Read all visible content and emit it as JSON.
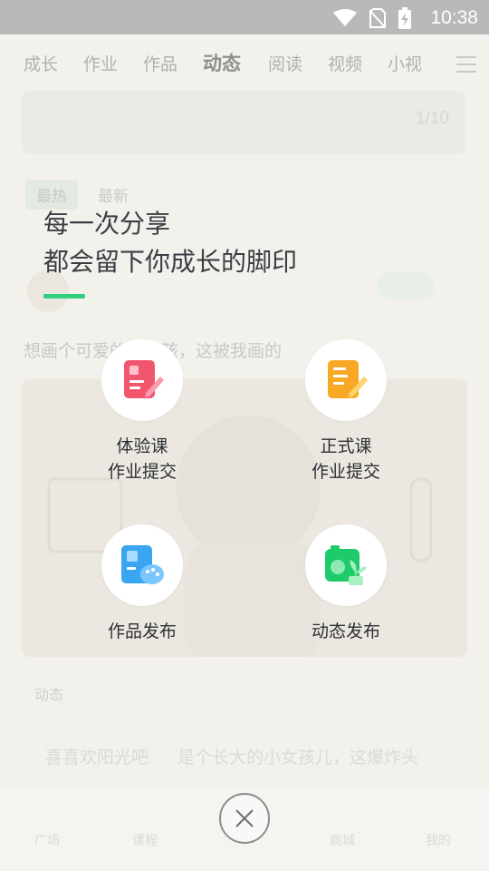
{
  "status_bar": {
    "time": "10:38"
  },
  "background": {
    "tabs": [
      "成长",
      "作业",
      "作品",
      "动态",
      "阅读",
      "视频",
      "小视"
    ],
    "active_tab": "动态",
    "banner_counter": "1/10",
    "chips": [
      "最热",
      "最新"
    ],
    "post_text": "想画个可爱的小女孩，这被我画的",
    "feed_label": "动态",
    "feed_name": "喜喜欢阳光吧",
    "feed_text": "是个长大的小女孩儿，这爆炸头",
    "bottom_nav": [
      "广场",
      "课程",
      "",
      "商城",
      "我的"
    ]
  },
  "overlay": {
    "heading_line1": "每一次分享",
    "heading_line2": "都会留下你成长的脚印",
    "actions": [
      {
        "line1": "体验课",
        "line2": "作业提交",
        "icon": "pink-notebook-pencil-icon"
      },
      {
        "line1": "正式课",
        "line2": "作业提交",
        "icon": "orange-notebook-pencil-icon"
      },
      {
        "line1": "作品发布",
        "line2": "",
        "icon": "palette-artwork-icon"
      },
      {
        "line1": "动态发布",
        "line2": "",
        "icon": "camera-sprout-icon"
      }
    ]
  },
  "colors": {
    "accent": "#2fcf7d",
    "pink": "#f2566f",
    "orange": "#f9a825",
    "blue": "#3aa6f2",
    "green": "#1ecb6b"
  }
}
